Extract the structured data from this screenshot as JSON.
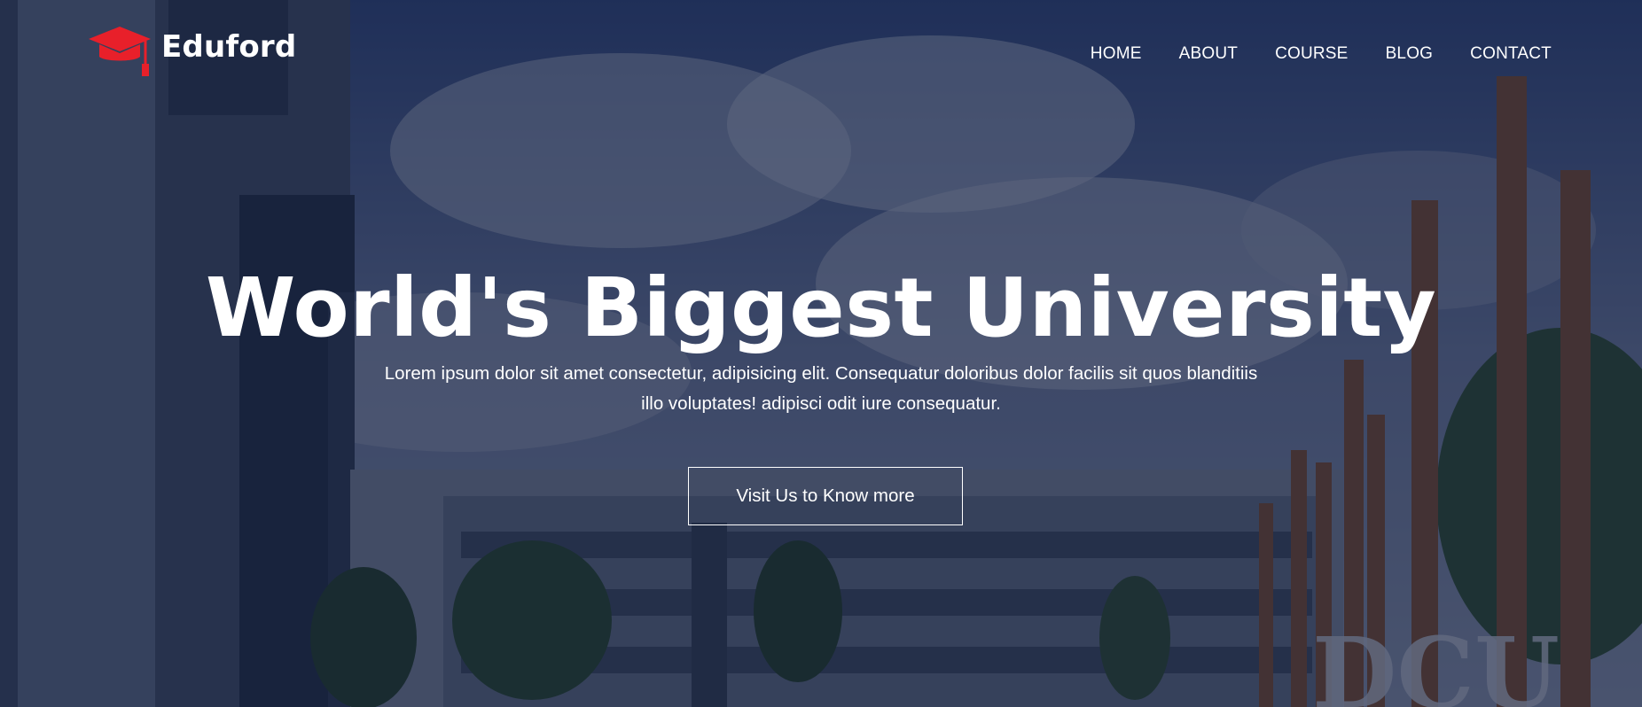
{
  "brand": {
    "name": "Eduford",
    "icon": "graduation-cap-icon",
    "icon_color": "#e8202a"
  },
  "nav": {
    "items": [
      {
        "label": "HOME"
      },
      {
        "label": "ABOUT"
      },
      {
        "label": "COURSE"
      },
      {
        "label": "BLOG"
      },
      {
        "label": "CONTACT"
      }
    ]
  },
  "hero": {
    "title": "World's Biggest University",
    "subtitle": "Lorem ipsum dolor sit amet consectetur, adipisicing elit. Consequatur doloribus dolor facilis sit quos blanditiis illo voluptates! adipisci odit iure consequatur.",
    "cta_label": "Visit Us to Know more"
  },
  "colors": {
    "overlay": "#081234",
    "text": "#ffffff",
    "accent": "#e8202a"
  }
}
